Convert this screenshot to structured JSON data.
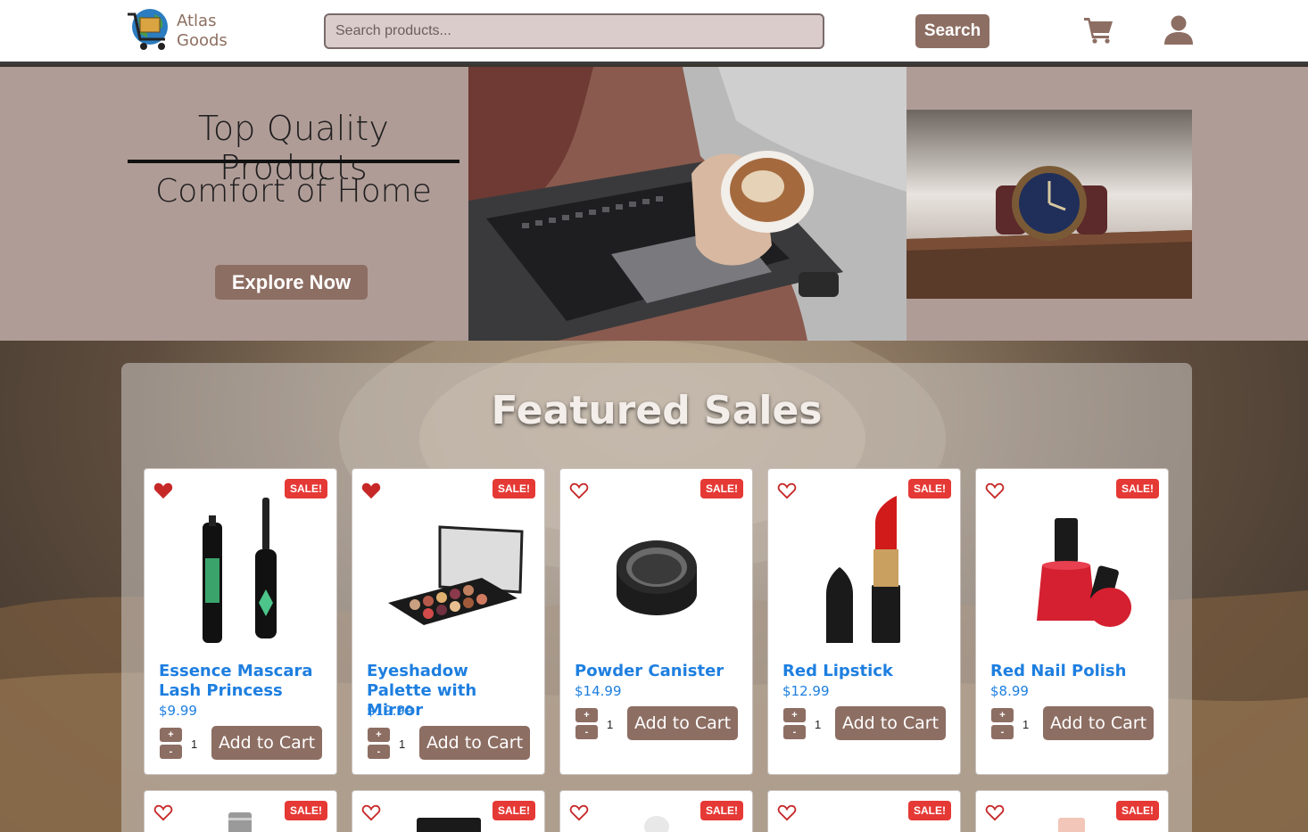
{
  "brand": {
    "line1": "Atlas",
    "line2": "Goods"
  },
  "search": {
    "placeholder": "Search products...",
    "button_label": "Search"
  },
  "hero": {
    "title": "Top Quality Products",
    "subtitle": "Comfort of Home",
    "button_label": "Explore Now"
  },
  "featured": {
    "title": "Featured Sales",
    "badge": "SALE!",
    "add_label": "Add to Cart",
    "plus": "+",
    "minus": "-",
    "products": [
      {
        "name": "Essence Mascara Lash Princess",
        "price": "$9.99",
        "qty": "1",
        "favorited": true
      },
      {
        "name": "Eyeshadow Palette with Mirror",
        "price": "$19.99",
        "qty": "1",
        "favorited": true
      },
      {
        "name": "Powder Canister",
        "price": "$14.99",
        "qty": "1",
        "favorited": false
      },
      {
        "name": "Red Lipstick",
        "price": "$12.99",
        "qty": "1",
        "favorited": false
      },
      {
        "name": "Red Nail Polish",
        "price": "$8.99",
        "qty": "1",
        "favorited": false
      }
    ],
    "row2_badges": [
      "SALE!",
      "SALE!",
      "SALE!",
      "SALE!",
      "SALE!"
    ]
  },
  "colors": {
    "accent": "#8d6e63",
    "link": "#1e7fe0",
    "sale": "#e53935",
    "hero_bg": "#b09c97"
  }
}
